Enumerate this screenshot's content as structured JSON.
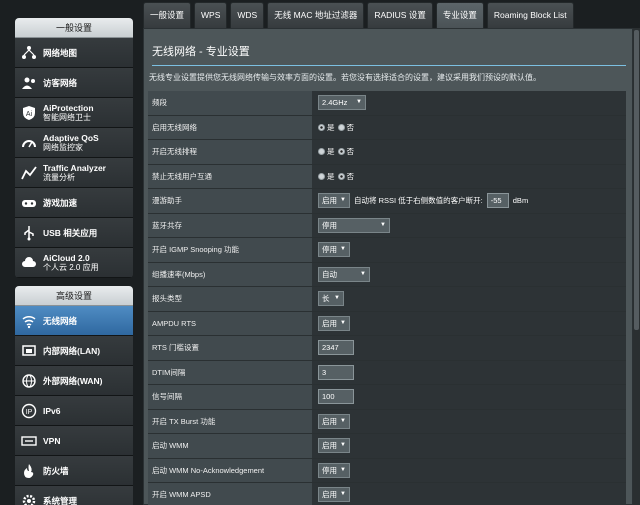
{
  "sidebar": {
    "general_title": "一般设置",
    "general_items": [
      {
        "l1": "网络地图",
        "l2": "",
        "icon": "network-map-icon"
      },
      {
        "l1": "访客网络",
        "l2": "",
        "icon": "guest-network-icon"
      },
      {
        "l1": "AiProtection",
        "l2": "智能网络卫士",
        "icon": "aiprotection-icon"
      },
      {
        "l1": "Adaptive QoS",
        "l2": "网络监控家",
        "icon": "qos-gauge-icon"
      },
      {
        "l1": "Traffic Analyzer",
        "l2": "流量分析",
        "icon": "traffic-analyzer-icon"
      },
      {
        "l1": "游戏加速",
        "l2": "",
        "icon": "game-boost-icon"
      },
      {
        "l1": "USB 相关应用",
        "l2": "",
        "icon": "usb-icon"
      },
      {
        "l1": "AiCloud 2.0",
        "l2": "个人云 2.0 应用",
        "icon": "aicloud-icon"
      }
    ],
    "advanced_title": "高级设置",
    "advanced_items": [
      {
        "l1": "无线网络",
        "l2": "",
        "icon": "wireless-icon",
        "active": true
      },
      {
        "l1": "内部网络(LAN)",
        "l2": "",
        "icon": "lan-icon"
      },
      {
        "l1": "外部网络(WAN)",
        "l2": "",
        "icon": "wan-globe-icon"
      },
      {
        "l1": "IPv6",
        "l2": "",
        "icon": "ipv6-icon"
      },
      {
        "l1": "VPN",
        "l2": "",
        "icon": "vpn-icon"
      },
      {
        "l1": "防火墙",
        "l2": "",
        "icon": "firewall-icon"
      },
      {
        "l1": "系统管理",
        "l2": "",
        "icon": "admin-gear-icon"
      }
    ]
  },
  "tabs": [
    {
      "label": "一般设置"
    },
    {
      "label": "WPS"
    },
    {
      "label": "WDS"
    },
    {
      "label": "无线 MAC 地址过滤器"
    },
    {
      "label": "RADIUS 设置"
    },
    {
      "label": "专业设置",
      "active": true
    },
    {
      "label": "Roaming Block List"
    }
  ],
  "main": {
    "title": "无线网络 - 专业设置",
    "description": "无线专业设置提供您无线网络传输与效率方面的设置。若您没有选择适合的设置，建议采用我们预设的默认值。",
    "settings": {
      "band": {
        "label": "频段",
        "value": "2.4GHz"
      },
      "enable_radio": {
        "label": "启用无线网络",
        "yes": "是",
        "no": "否",
        "selected": "是"
      },
      "schedule": {
        "label": "开启无线排程",
        "yes": "是",
        "no": "否",
        "selected": "否"
      },
      "isolation": {
        "label": "禁止无线用户互通",
        "yes": "是",
        "no": "否",
        "selected": "否"
      },
      "roaming": {
        "label": "漫游助手",
        "value": "启用",
        "text1": "自动将 RSSI 低于右侧数值的客户断开:",
        "rssi": "-55",
        "unit": "dBm"
      },
      "bluetooth": {
        "label": "蓝牙共存",
        "value": "停用"
      },
      "igmp": {
        "label": "开启 IGMP Snooping 功能",
        "value": "停用"
      },
      "multicast": {
        "label": "组播速率(Mbps)",
        "value": "自动"
      },
      "preamble": {
        "label": "报头类型",
        "value": "长"
      },
      "ampdu_rts": {
        "label": "AMPDU RTS",
        "value": "启用"
      },
      "rts": {
        "label": "RTS 门槛设置",
        "value": "2347"
      },
      "dtim": {
        "label": "DTIM间隔",
        "value": "3"
      },
      "beacon": {
        "label": "信号间隔",
        "value": "100"
      },
      "txburst": {
        "label": "开启 TX Burst 功能",
        "value": "启用"
      },
      "wmm": {
        "label": "启动 WMM",
        "value": "启用"
      },
      "wmm_noack": {
        "label": "启动 WMM No-Acknowledgement",
        "value": "停用"
      },
      "wmm_apsd": {
        "label": "开启 WMM APSD",
        "value": "启用"
      }
    }
  }
}
